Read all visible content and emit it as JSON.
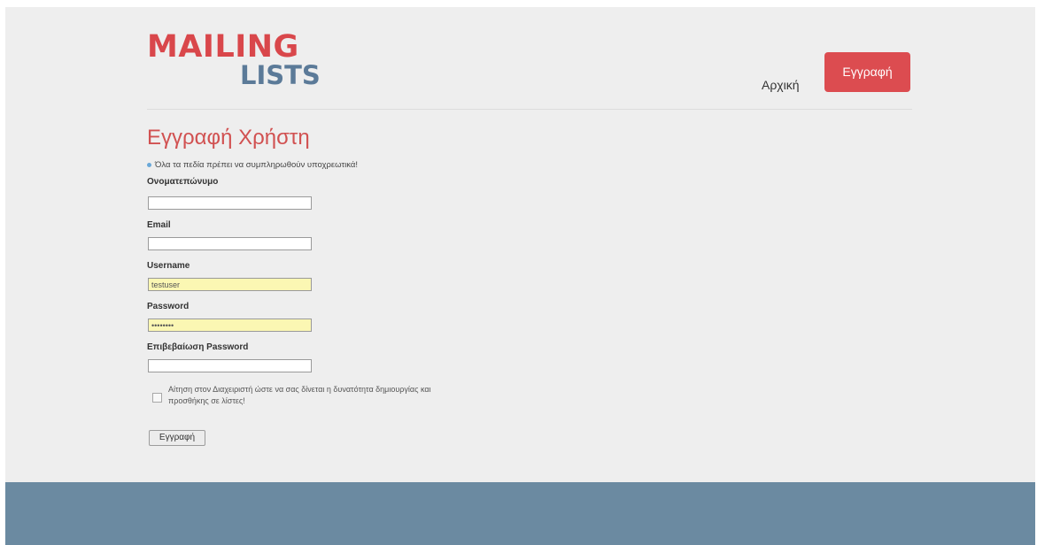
{
  "header": {
    "logo_top": "MAILING",
    "logo_bottom": "LISTS",
    "nav_home": "Αρχική",
    "nav_register": "Εγγραφή"
  },
  "form": {
    "title": "Εγγραφή Χρήστη",
    "required_note": "Όλα τα πεδία πρέπει να συμπληρωθούν υποχρεωτικά!",
    "fields": [
      {
        "label": "Ονοματεπώνυμο",
        "value": ""
      },
      {
        "label": "Email",
        "value": ""
      },
      {
        "label": "Username",
        "value": "testuser"
      },
      {
        "label": "Password",
        "value": "••••••••"
      },
      {
        "label": "Επιβεβαίωση Password",
        "value": ""
      }
    ],
    "checkbox_label": "Αίτηση στον Διαχειριστή ώστε να σας δίνεται η δυνατότητα δημιουργίας και προσθήκης σε λίστες!",
    "checkbox_checked": false,
    "submit_label": "Εγγραφή"
  },
  "colors": {
    "brand_red": "#d9474b",
    "brand_blue": "#5b7a98",
    "footer": "#6b8aa1",
    "autofill": "#fbf7b3"
  }
}
